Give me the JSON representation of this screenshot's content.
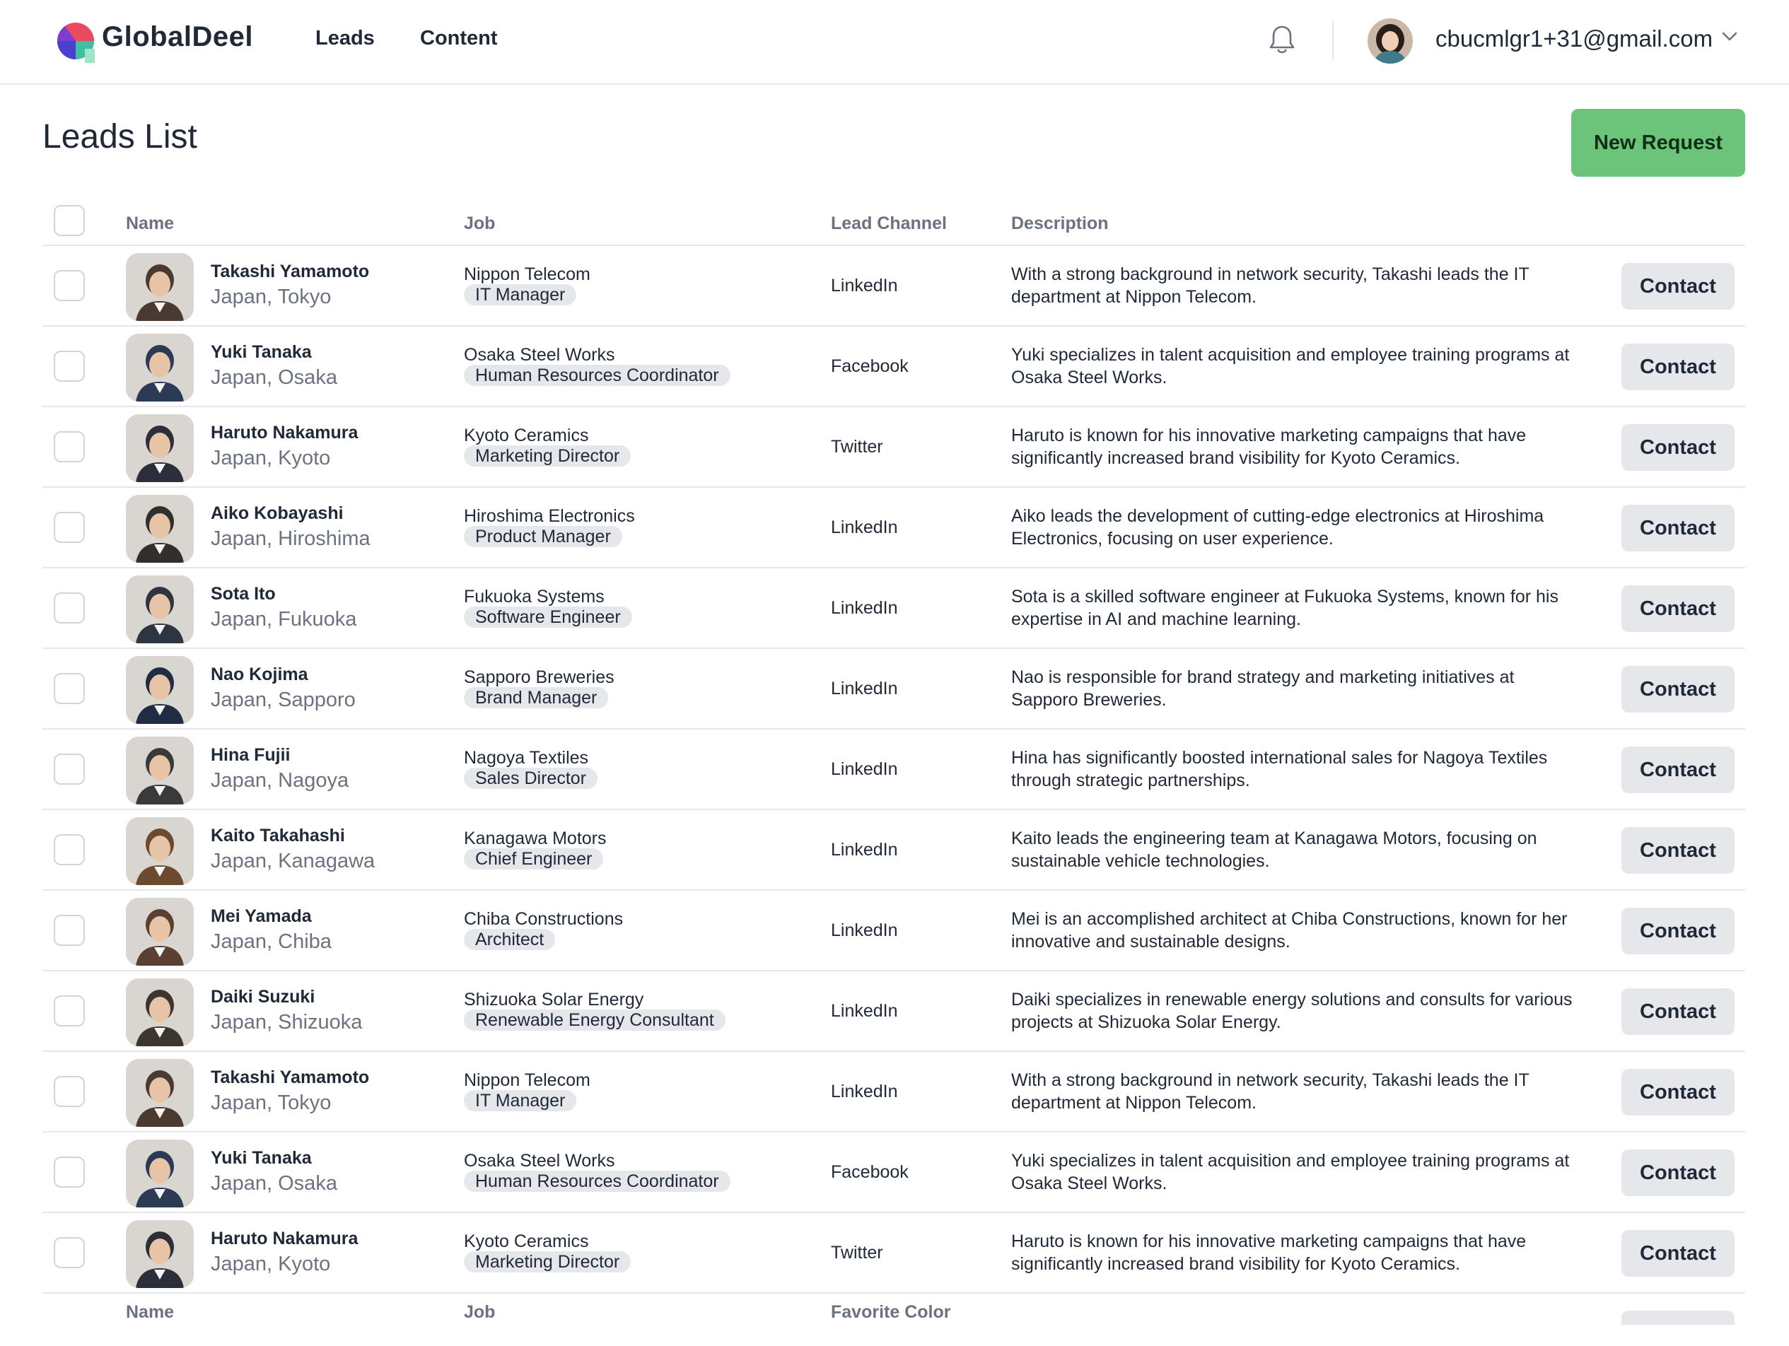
{
  "app": {
    "brand": "GlobalDeel"
  },
  "nav": {
    "leads": "Leads",
    "content": "Content"
  },
  "user": {
    "email": "cbucmlgr1+31@gmail.com"
  },
  "page": {
    "title": "Leads List",
    "new_request": "New Request"
  },
  "table": {
    "headers": {
      "name": "Name",
      "job": "Job",
      "channel": "Lead Channel",
      "description": "Description"
    },
    "footer_headers": {
      "name": "Name",
      "job": "Job",
      "channel": "Favorite Color"
    },
    "contact_label": "Contact",
    "rows": [
      {
        "name": "Takashi Yamamoto",
        "location": "Japan, Tokyo",
        "company": "Nippon Telecom",
        "role": "IT Manager",
        "channel": "LinkedIn",
        "description": "With a strong background in network security, Takashi leads the IT department at Nippon Telecom.",
        "contact": "Contact",
        "avatar_color": "#4a3a30"
      },
      {
        "name": "Yuki Tanaka",
        "location": "Japan, Osaka",
        "company": "Osaka Steel Works",
        "role": "Human Resources Coordinator",
        "channel": "Facebook",
        "description": "Yuki specializes in talent acquisition and employee training programs at Osaka Steel Works.",
        "contact": "Contact",
        "avatar_color": "#2b3a55"
      },
      {
        "name": "Haruto Nakamura",
        "location": "Japan, Kyoto",
        "company": "Kyoto Ceramics",
        "role": "Marketing Director",
        "channel": "Twitter",
        "description": "Haruto is known for his innovative marketing campaigns that have significantly increased brand visibility for Kyoto Ceramics.",
        "contact": "Contact",
        "avatar_color": "#2c2f3a"
      },
      {
        "name": "Aiko Kobayashi",
        "location": "Japan, Hiroshima",
        "company": "Hiroshima Electronics",
        "role": "Product Manager",
        "channel": "LinkedIn",
        "description": "Aiko leads the development of cutting-edge electronics at Hiroshima Electronics, focusing on user experience.",
        "contact": "Contact",
        "avatar_color": "#33302c"
      },
      {
        "name": "Sota Ito",
        "location": "Japan, Fukuoka",
        "company": "Fukuoka Systems",
        "role": "Software Engineer",
        "channel": "LinkedIn",
        "description": "Sota is a skilled software engineer at Fukuoka Systems, known for his expertise in AI and machine learning.",
        "contact": "Contact",
        "avatar_color": "#2d3540"
      },
      {
        "name": "Nao Kojima",
        "location": "Japan, Sapporo",
        "company": "Sapporo Breweries",
        "role": "Brand Manager",
        "channel": "LinkedIn",
        "description": "Nao is responsible for brand strategy and marketing initiatives at Sapporo Breweries.",
        "contact": "Contact",
        "avatar_color": "#1f2c44"
      },
      {
        "name": "Hina Fujii",
        "location": "Japan, Nagoya",
        "company": "Nagoya Textiles",
        "role": "Sales Director",
        "channel": "LinkedIn",
        "description": "Hina has significantly boosted international sales for Nagoya Textiles through strategic partnerships.",
        "contact": "Contact",
        "avatar_color": "#3a3a3a"
      },
      {
        "name": "Kaito Takahashi",
        "location": "Japan, Kanagawa",
        "company": "Kanagawa Motors",
        "role": "Chief Engineer",
        "channel": "LinkedIn",
        "description": "Kaito leads the engineering team at Kanagawa Motors, focusing on sustainable vehicle technologies.",
        "contact": "Contact",
        "avatar_color": "#6b4a2e"
      },
      {
        "name": "Mei Yamada",
        "location": "Japan, Chiba",
        "company": "Chiba Constructions",
        "role": "Architect",
        "channel": "LinkedIn",
        "description": "Mei is an accomplished architect at Chiba Constructions, known for her innovative and sustainable designs.",
        "contact": "Contact",
        "avatar_color": "#5a4030"
      },
      {
        "name": "Daiki Suzuki",
        "location": "Japan, Shizuoka",
        "company": "Shizuoka Solar Energy",
        "role": "Renewable Energy Consultant",
        "channel": "LinkedIn",
        "description": "Daiki specializes in renewable energy solutions and consults for various projects at Shizuoka Solar Energy.",
        "contact": "Contact",
        "avatar_color": "#3d3530"
      },
      {
        "name": "Takashi Yamamoto",
        "location": "Japan, Tokyo",
        "company": "Nippon Telecom",
        "role": "IT Manager",
        "channel": "LinkedIn",
        "description": "With a strong background in network security, Takashi leads the IT department at Nippon Telecom.",
        "contact": "Contact",
        "avatar_color": "#4a3a30"
      },
      {
        "name": "Yuki Tanaka",
        "location": "Japan, Osaka",
        "company": "Osaka Steel Works",
        "role": "Human Resources Coordinator",
        "channel": "Facebook",
        "description": "Yuki specializes in talent acquisition and employee training programs at Osaka Steel Works.",
        "contact": "Contact",
        "avatar_color": "#2b3a55"
      },
      {
        "name": "Haruto Nakamura",
        "location": "Japan, Kyoto",
        "company": "Kyoto Ceramics",
        "role": "Marketing Director",
        "channel": "Twitter",
        "description": "Haruto is known for his innovative marketing campaigns that have significantly increased brand visibility for Kyoto Ceramics.",
        "contact": "Contact",
        "avatar_color": "#2c2f3a"
      }
    ]
  },
  "colors": {
    "accent": "#6bc47a",
    "border": "#e5e7eb",
    "muted_text": "#6b7280"
  }
}
